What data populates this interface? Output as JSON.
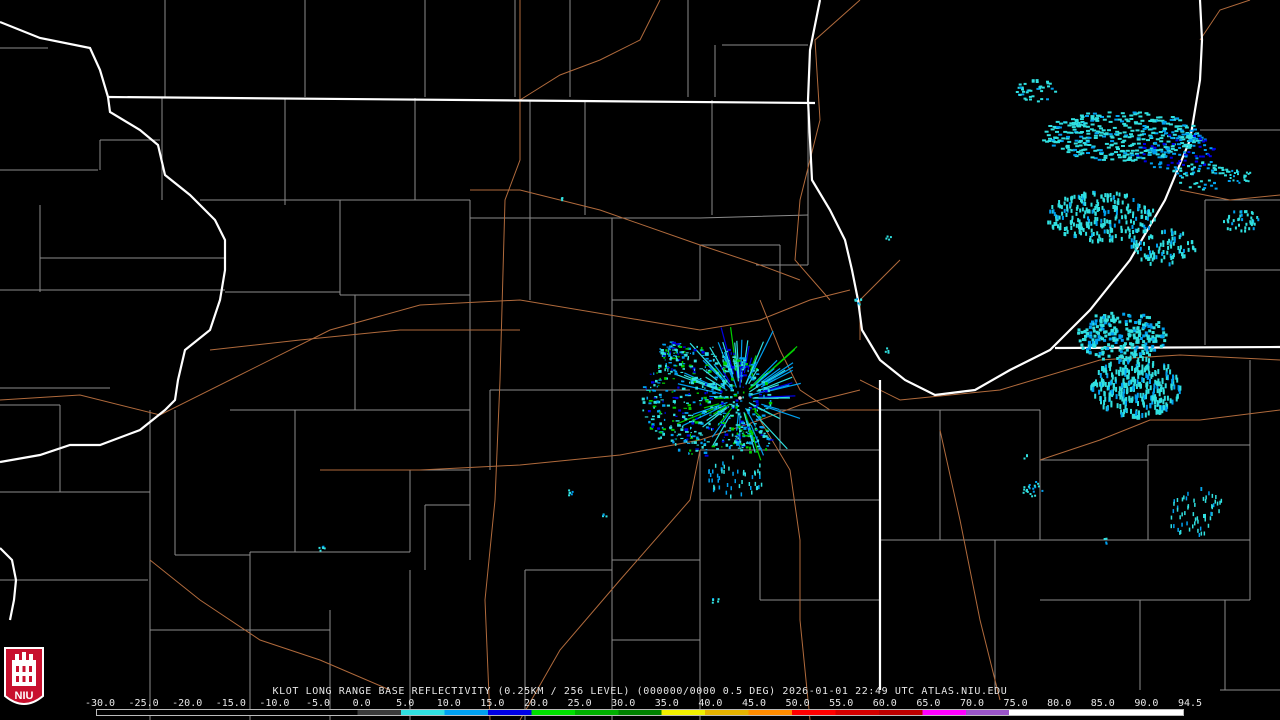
{
  "product": {
    "title": "KLOT LONG RANGE BASE REFLECTIVITY (0.25KM / 256 LEVEL) (000000/0000 0.5 DEG) 2026-01-01 22:49 UTC  ATLAS.NIU.EDU"
  },
  "colorbar": {
    "ticks": [
      "-30.0",
      "-25.0",
      "-20.0",
      "-15.0",
      "-10.0",
      "-5.0",
      "0.0",
      "5.0",
      "10.0",
      "15.0",
      "20.0",
      "25.0",
      "30.0",
      "35.0",
      "40.0",
      "45.0",
      "50.0",
      "55.0",
      "60.0",
      "65.0",
      "70.0",
      "75.0",
      "80.0",
      "85.0",
      "90.0",
      "94.5"
    ],
    "colors": [
      "#000000",
      "#000000",
      "#000000",
      "#000000",
      "#000000",
      "#000000",
      "#3a3a3a",
      "#30e0e0",
      "#00a0f0",
      "#0000e6",
      "#00e000",
      "#00b000",
      "#008000",
      "#f0f000",
      "#e6b400",
      "#ff8c00",
      "#ff0000",
      "#d40000",
      "#bc0000",
      "#ff00ff",
      "#9a55c8",
      "#ffffff",
      "#ffffff",
      "#ffffff",
      "#ffffff"
    ]
  },
  "logo": {
    "text": "NIU"
  },
  "colors": {
    "state_border": "#ffffff",
    "county_border": "#8c8c8c",
    "highway": "#b06a3c",
    "echo_light": "#30e0e0",
    "echo_mid": "#00a0f0",
    "echo_blue": "#0000e6",
    "echo_green": "#00d000"
  }
}
